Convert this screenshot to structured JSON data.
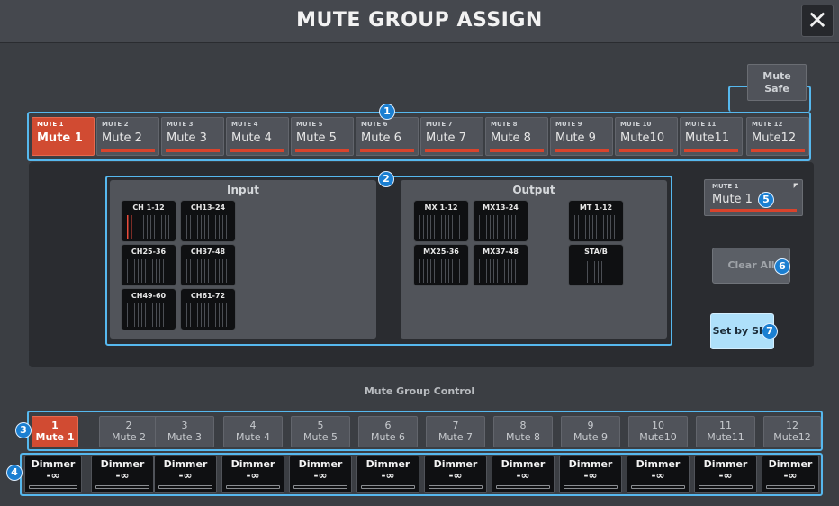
{
  "title": "MUTE GROUP ASSIGN",
  "close_icon": "close-icon",
  "mute_safe": {
    "line1": "Mute",
    "line2": "Safe"
  },
  "mute_tabs": [
    {
      "small": "MUTE 1",
      "big": "Mute 1",
      "selected": true
    },
    {
      "small": "MUTE 2",
      "big": "Mute 2"
    },
    {
      "small": "MUTE 3",
      "big": "Mute 3"
    },
    {
      "small": "MUTE 4",
      "big": "Mute 4"
    },
    {
      "small": "MUTE 5",
      "big": "Mute 5"
    },
    {
      "small": "MUTE 6",
      "big": "Mute 6"
    },
    {
      "small": "MUTE 7",
      "big": "Mute 7"
    },
    {
      "small": "MUTE 8",
      "big": "Mute 8"
    },
    {
      "small": "MUTE 9",
      "big": "Mute 9"
    },
    {
      "small": "MUTE 10",
      "big": "Mute10"
    },
    {
      "small": "MUTE 11",
      "big": "Mute11"
    },
    {
      "small": "MUTE 12",
      "big": "Mute12"
    }
  ],
  "input": {
    "heading": "Input",
    "groups": [
      "CH 1-12",
      "CH13-24",
      "CH25-36",
      "CH37-48",
      "CH49-60",
      "CH61-72"
    ]
  },
  "output": {
    "heading": "Output",
    "groups": [
      "MX 1-12",
      "MX13-24",
      "MT 1-12",
      "MX25-36",
      "MX37-48",
      "STA/B"
    ]
  },
  "current_mute": {
    "small": "MUTE 1",
    "big": "Mute 1"
  },
  "clear_all_label": "Clear All",
  "set_by_sel_label": "Set by SEL",
  "mute_group_control_label": "Mute Group Control",
  "control_buttons": [
    {
      "num": "1",
      "name": "Mute 1",
      "selected": true
    },
    {
      "num": "2",
      "name": "Mute 2"
    },
    {
      "num": "3",
      "name": "Mute 3"
    },
    {
      "num": "4",
      "name": "Mute 4"
    },
    {
      "num": "5",
      "name": "Mute 5"
    },
    {
      "num": "6",
      "name": "Mute 6"
    },
    {
      "num": "7",
      "name": "Mute 7"
    },
    {
      "num": "8",
      "name": "Mute 8"
    },
    {
      "num": "9",
      "name": "Mute 9"
    },
    {
      "num": "10",
      "name": "Mute10"
    },
    {
      "num": "11",
      "name": "Mute11"
    },
    {
      "num": "12",
      "name": "Mute12"
    }
  ],
  "dimmer": {
    "label": "Dimmer",
    "value": "-∞"
  },
  "callouts": [
    "1",
    "2",
    "3",
    "4",
    "5",
    "6",
    "7"
  ],
  "colors": {
    "active": "#d14b32",
    "highlight": "#56b8ee",
    "indicator": "#d9432c"
  }
}
